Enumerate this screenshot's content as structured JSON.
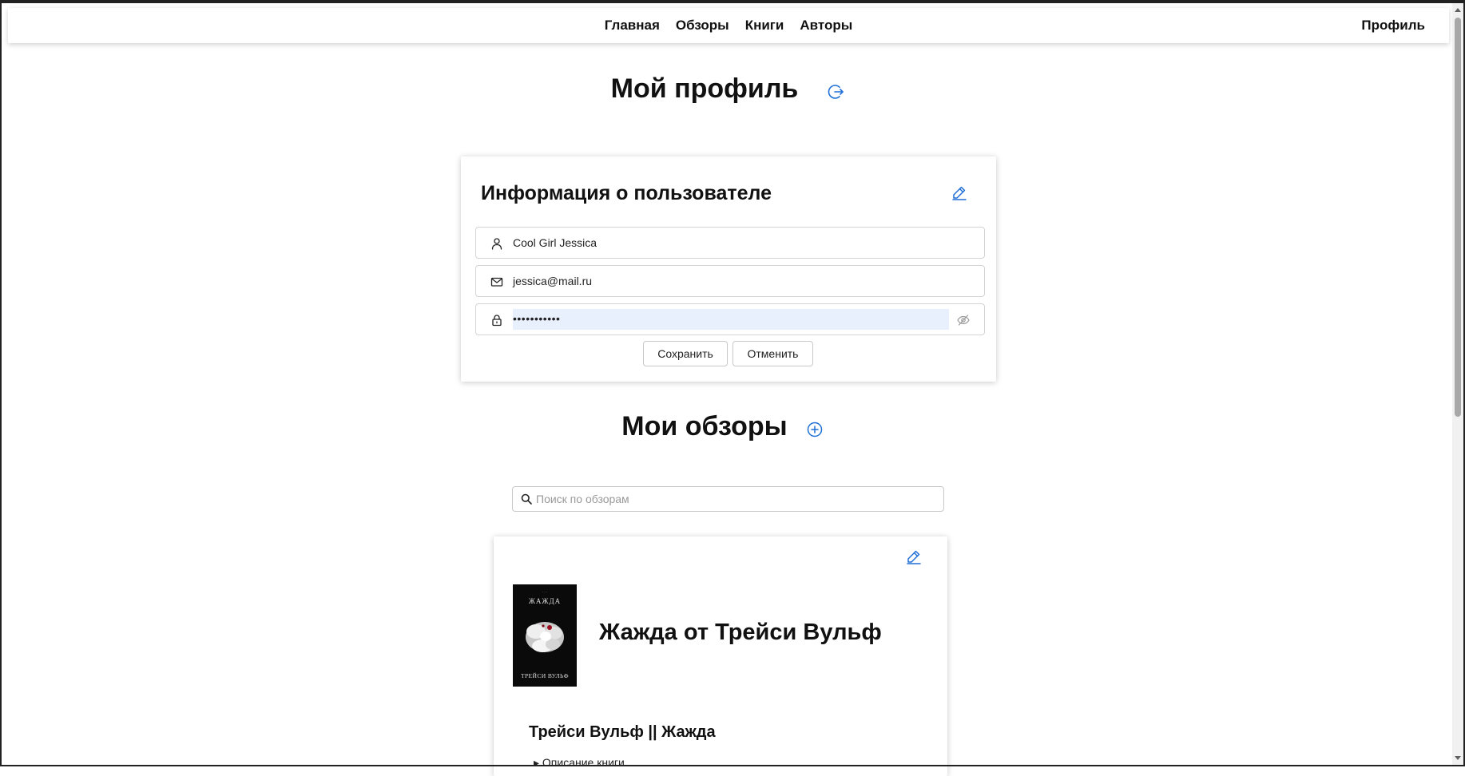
{
  "nav": {
    "links": [
      "Главная",
      "Обзоры",
      "Книги",
      "Авторы"
    ],
    "profile": "Профиль"
  },
  "profile_section": {
    "title": "Мой профиль",
    "logout_icon": "logout-icon"
  },
  "user_info": {
    "title": "Информация о пользователе",
    "edit_icon": "pencil-icon",
    "username": "Cool Girl Jessica",
    "email": "jessica@mail.ru",
    "password_masked": "•••••••••••",
    "save_label": "Сохранить",
    "cancel_label": "Отменить"
  },
  "reviews_section": {
    "title": "Мои обзоры",
    "add_icon": "plus-circle-icon",
    "search_placeholder": "Поиск по обзорам"
  },
  "review": {
    "title": "Жажда от Трейси Вульф",
    "subtitle": "Трейси Вульф || Жажда",
    "details_label": "Описание книги",
    "cover_top_text": "ЖАЖДА",
    "cover_author_text": "ТРЕЙСИ ВУЛЬФ"
  },
  "colors": {
    "accent": "#1f6fd6",
    "text": "#111111",
    "password_highlight": "#e8f0fe"
  }
}
